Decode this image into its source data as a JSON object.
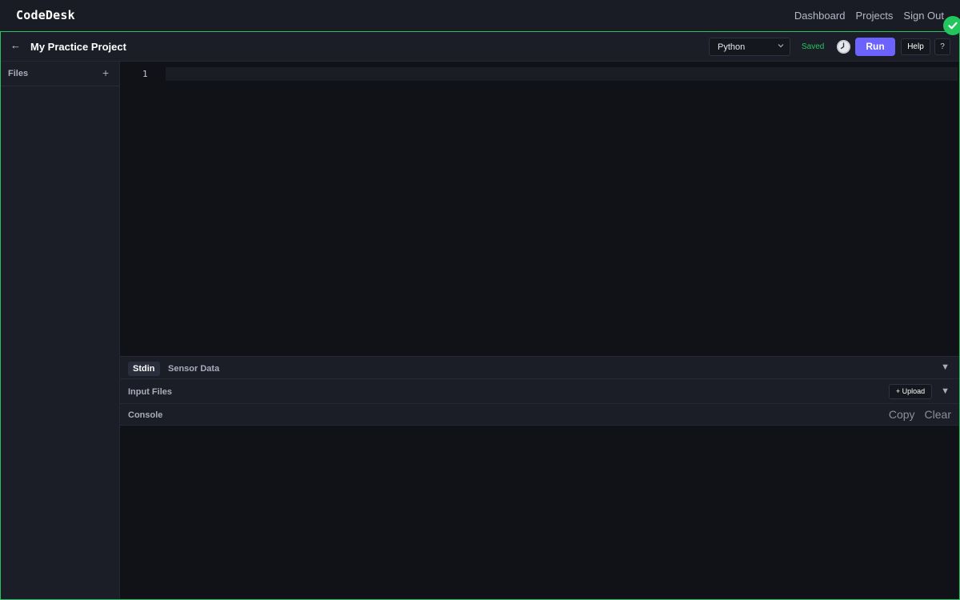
{
  "app": {
    "brand": "CodeDesk"
  },
  "nav": {
    "links": [
      "Dashboard",
      "Projects",
      "Sign Out"
    ]
  },
  "toolbar": {
    "back_icon": "←",
    "project_title": "My Practice Project",
    "language": "Python",
    "save_status": "Saved",
    "run_label": "Run",
    "help_label": "Help",
    "question_label": "?"
  },
  "sidebar": {
    "files_label": "Files",
    "add_icon": "+"
  },
  "editor": {
    "line_numbers": [
      "1"
    ]
  },
  "panels": {
    "tabs": [
      "Stdin",
      "Sensor Data"
    ],
    "input_files_label": "Input Files",
    "upload_label": "+ Upload",
    "console_label": "Console",
    "copy_label": "Copy",
    "clear_label": "Clear",
    "collapse_icon": "▼"
  },
  "colors": {
    "accent": "#6c63ff",
    "success": "#22c55e",
    "editor_bg": "#111217"
  },
  "icons": {
    "status": "check-circle-icon",
    "history": "clock-icon",
    "language_dropdown": "chevron-down-icon"
  }
}
